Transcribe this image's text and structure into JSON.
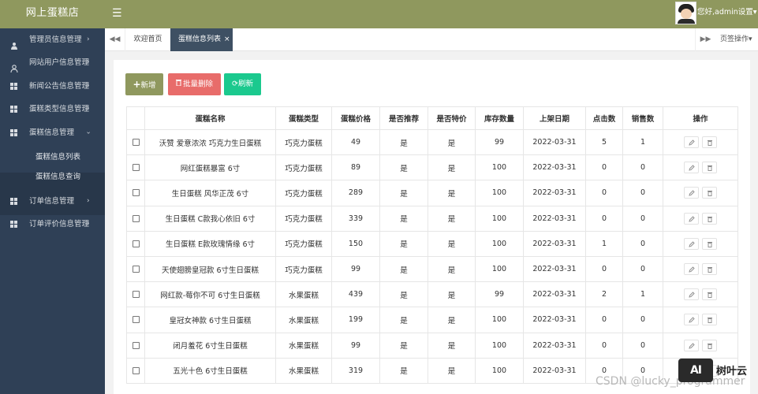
{
  "header": {
    "brand": "网上蛋糕店",
    "menu_icon": "hamburger-icon",
    "user_text": "您好,admin设置▾"
  },
  "sidebar": {
    "items": [
      {
        "label": "管理员信息管理",
        "icon": "user-group-icon"
      },
      {
        "label": "网站用户信息管理",
        "icon": "user-icon"
      },
      {
        "label": "新闻公告信息管理",
        "icon": "grid-icon"
      },
      {
        "label": "蛋糕类型信息管理",
        "icon": "grid-icon"
      },
      {
        "label": "蛋糕信息管理",
        "icon": "grid-icon"
      },
      {
        "label": "订单信息管理",
        "icon": "grid-icon"
      },
      {
        "label": "订单评价信息管理",
        "icon": "grid-icon"
      }
    ],
    "subitems": [
      {
        "label": "蛋糕信息列表"
      },
      {
        "label": "蛋糕信息查询"
      }
    ]
  },
  "tabs": {
    "items": [
      {
        "label": "欢迎首页"
      },
      {
        "label": "蛋糕信息列表"
      }
    ],
    "close_glyph": "×",
    "ops_label": "页签操作▾"
  },
  "toolbar": {
    "add_label": "新增",
    "delete_label": "批量删除",
    "refresh_label": "刷新"
  },
  "table": {
    "columns": [
      "",
      "蛋糕名称",
      "蛋糕类型",
      "蛋糕价格",
      "是否推荐",
      "是否特价",
      "库存数量",
      "上架日期",
      "点击数",
      "销售数",
      "操作"
    ],
    "rows": [
      [
        "沃赞 爱意浓浓 巧克力生日蛋糕",
        "巧克力蛋糕",
        "49",
        "是",
        "是",
        "99",
        "2022-03-31",
        "5",
        "1"
      ],
      [
        "网红蛋糕暴富 6寸",
        "巧克力蛋糕",
        "89",
        "是",
        "是",
        "100",
        "2022-03-31",
        "0",
        "0"
      ],
      [
        "生日蛋糕 风华正茂 6寸",
        "巧克力蛋糕",
        "289",
        "是",
        "是",
        "100",
        "2022-03-31",
        "0",
        "0"
      ],
      [
        "生日蛋糕 C款我心依旧 6寸",
        "巧克力蛋糕",
        "339",
        "是",
        "是",
        "100",
        "2022-03-31",
        "0",
        "0"
      ],
      [
        "生日蛋糕 E款玫瑰情缘 6寸",
        "巧克力蛋糕",
        "150",
        "是",
        "是",
        "100",
        "2022-03-31",
        "1",
        "0"
      ],
      [
        "天使翅膀皇冠款 6寸生日蛋糕",
        "巧克力蛋糕",
        "99",
        "是",
        "是",
        "100",
        "2022-03-31",
        "0",
        "0"
      ],
      [
        "网红款-莓你不可 6寸生日蛋糕",
        "水果蛋糕",
        "439",
        "是",
        "是",
        "99",
        "2022-03-31",
        "2",
        "1"
      ],
      [
        "皇冠女神款 6寸生日蛋糕",
        "水果蛋糕",
        "199",
        "是",
        "是",
        "100",
        "2022-03-31",
        "0",
        "0"
      ],
      [
        "闭月羞花 6寸生日蛋糕",
        "水果蛋糕",
        "99",
        "是",
        "是",
        "100",
        "2022-03-31",
        "0",
        "0"
      ],
      [
        "五光十色 6寸生日蛋糕",
        "水果蛋糕",
        "319",
        "是",
        "是",
        "100",
        "2022-03-31",
        "0",
        "0"
      ]
    ]
  },
  "watermark": {
    "logo": "AI",
    "brand": "树叶云",
    "csdn": "CSDN @lucky_programmer"
  },
  "colors": {
    "header": "#8f985e",
    "sidebar": "#2f4056",
    "active_tab": "#3e5063",
    "delete_button": "#e86c6a",
    "refresh_button": "#1bc98e"
  }
}
